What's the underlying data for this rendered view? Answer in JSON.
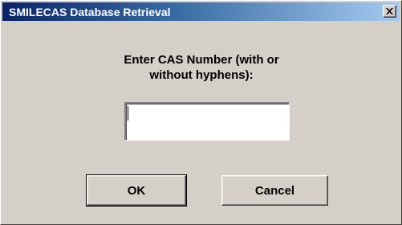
{
  "window": {
    "title": "SMILECAS Database Retrieval"
  },
  "titlebar": {
    "close_icon": "close-icon"
  },
  "prompt": {
    "line1": "Enter CAS Number (with or",
    "line2": "without hyphens):"
  },
  "cas_input": {
    "value": ""
  },
  "buttons": {
    "ok_label": "OK",
    "cancel_label": "Cancel"
  },
  "colors": {
    "dialog_background": "#d4d0c8",
    "titlebar_start": "#0a246a",
    "titlebar_end": "#a6caf0",
    "title_text": "#ffffff"
  }
}
